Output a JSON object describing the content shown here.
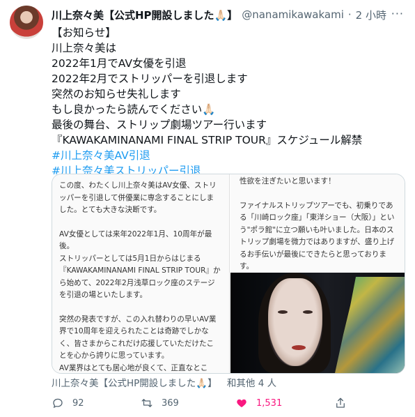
{
  "tweet": {
    "display_name": "川上奈々美【公式HP開設しました🙏🏻】",
    "handle": "@nanamikawakami",
    "separator": "·",
    "time": "2 小時",
    "more_icon": "more-icon",
    "lines": [
      "【お知らせ】",
      "川上奈々美は",
      "2022年1月でAV女優を引退",
      "2022年2月でストリッパーを引退します",
      "突然のお知らせ失礼します",
      "もし良かったら読んでください🙏🏻",
      "最後の舞台、ストリップ劇場ツアー行います",
      "『KAWAKAMINANAMI FINAL STRIP TOUR』スケジュール解禁"
    ],
    "hashtags": [
      "#川上奈々美AV引退",
      "#川上奈々美ストリッパー引退"
    ],
    "link_color": "#1d9bf0"
  },
  "card": {
    "left_paragraphs": [
      "この度、わたくし川上奈々美はAV女優、ストリッパーを引退して併優業に専念することにしました。とても大きな決断です。",
      "AV女優としては来年2022年1月、10周年が最後。\nストリッパーとしては5月1日からはじまる『KAWAKAMINANAMI FINAL STRIP TOUR』から始めて、2022年2月浅草ロック座のステージを引退の場といたします。",
      "突然の発表ですが、この入れ替わりの早いAV業界で10周年を迎えられたことは奇跡でしかなく、皆さまからこれだけ応援していただけたことを心から誇りに思っています。\nAV業界はとても居心地が良くて、正直なところ、\"現役AV女優\"という肩書きを失うのが怖"
    ],
    "right_paragraphs": [
      "性欲を注ぎたいと思います！",
      "ファイナルストリップツアーでも、初乗りである「川崎ロック座」「東洋ショー（大阪）」という\"ポラ館\"に立つ願いも叶いました。日本のストリップ劇場を微力ではありますが、盛り上げるお手伝いが最後にできたらと思っております。\nぜひこの生命力溢れる、本当に素敵な日本の"
    ]
  },
  "footer": {
    "liked_by_name": "川上奈々美【公式HP開設しました🙏🏻】",
    "liked_by_suffix": "和其他 4 人"
  },
  "actions": {
    "reply_count": "92",
    "retweet_count": "369",
    "like_count": "1,531",
    "like_color": "#f91880"
  }
}
